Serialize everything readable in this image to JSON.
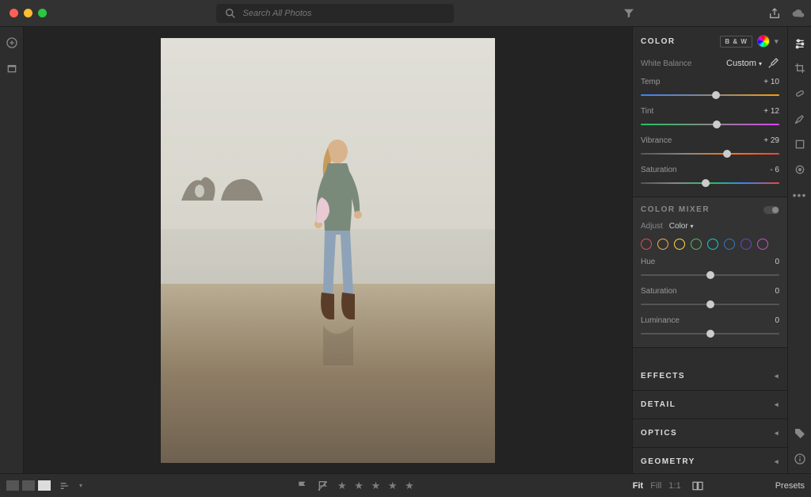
{
  "search": {
    "placeholder": "Search All Photos"
  },
  "panel": {
    "color": {
      "title": "COLOR",
      "bw_label": "B & W",
      "wb_label": "White Balance",
      "wb_value": "Custom",
      "sliders": {
        "temp": {
          "label": "Temp",
          "value": "+ 10",
          "pos": 54
        },
        "tint": {
          "label": "Tint",
          "value": "+ 12",
          "pos": 55
        },
        "vibrance": {
          "label": "Vibrance",
          "value": "+ 29",
          "pos": 62
        },
        "saturation": {
          "label": "Saturation",
          "value": "- 6",
          "pos": 47
        }
      }
    },
    "mixer": {
      "title": "COLOR MIXER",
      "adjust_label": "Adjust",
      "adjust_value": "Color",
      "swatches": [
        "#d9534f",
        "#f0ad4e",
        "#ffd84d",
        "#5cb85c",
        "#17c9c9",
        "#337ab7",
        "#6f42c1",
        "#c154c1"
      ],
      "sliders": {
        "hue": {
          "label": "Hue",
          "value": "0",
          "pos": 50
        },
        "saturation": {
          "label": "Saturation",
          "value": "0",
          "pos": 50
        },
        "luminance": {
          "label": "Luminance",
          "value": "0",
          "pos": 50
        }
      }
    },
    "collapsed": {
      "effects": "EFFECTS",
      "detail": "DETAIL",
      "optics": "OPTICS",
      "geometry": "GEOMETRY"
    }
  },
  "bottom": {
    "zoom": {
      "fit": "Fit",
      "fill": "Fill",
      "one": "1:1"
    },
    "presets": "Presets"
  }
}
